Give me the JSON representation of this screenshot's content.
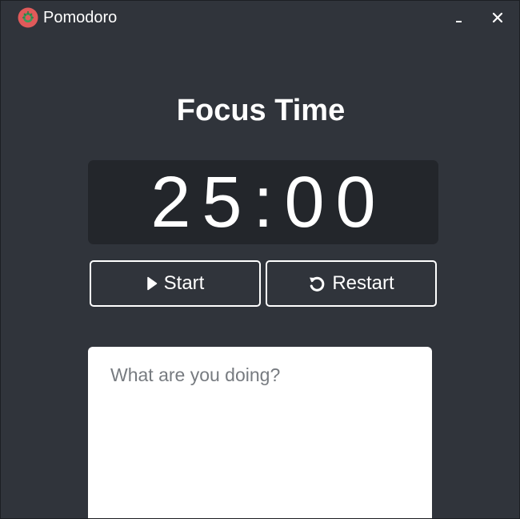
{
  "window": {
    "title": "Pomodoro",
    "app_icon": "tomato-icon",
    "minimize_icon": "minimize-icon",
    "close_icon": "close-icon"
  },
  "main": {
    "heading": "Focus Time",
    "timer": "25:00",
    "start_label": "Start",
    "start_icon": "play-icon",
    "restart_label": "Restart",
    "restart_icon": "restart-icon",
    "notes_placeholder": "What are you doing?",
    "notes_value": ""
  },
  "colors": {
    "background": "#30343b",
    "timer_background": "#23262b",
    "accent_tomato": "#e05a5a",
    "text": "#ffffff"
  }
}
